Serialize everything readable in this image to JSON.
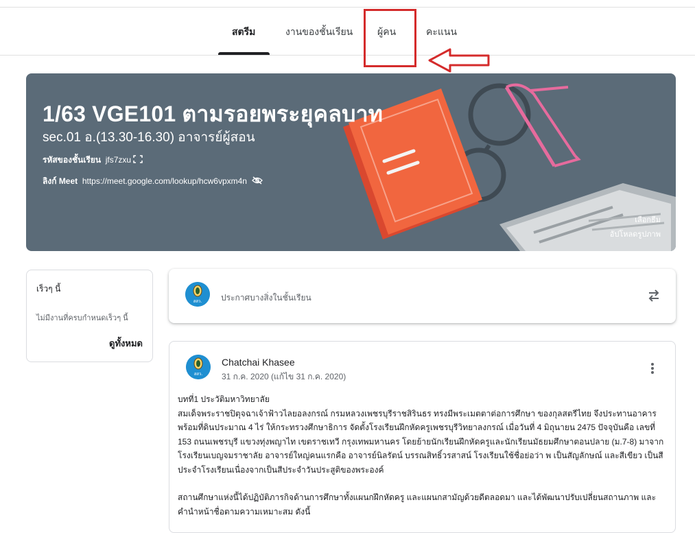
{
  "tabs": [
    "สตรีม",
    "งานของชั้นเรียน",
    "ผู้คน",
    "คะแนน"
  ],
  "banner": {
    "title": "1/63 VGE101 ตามรอยพระยุคลบาท",
    "section": "sec.01 อ.(13.30-16.30) อาจารย์ผู้สอน",
    "code_label": "รหัสของชั้นเรียน",
    "code_value": "jfs7zxu",
    "meet_label": "ลิงก์ Meet",
    "meet_url": "https://meet.google.com/lookup/hcw6vpxm4n",
    "select_theme": "เลือกธีม",
    "upload_photo": "อัปโหลดรูปภาพ"
  },
  "upcoming": {
    "title": "เร็วๆ นี้",
    "none": "ไม่มีงานที่ครบกำหนดเร็วๆ นี้",
    "view_all": "ดูทั้งหมด"
  },
  "announce": {
    "placeholder": "ประกาศบางสิ่งในชั้นเรียน",
    "avatar_text": "สสว."
  },
  "post": {
    "author": "Chatchai Khasee",
    "date": "31 ก.ค. 2020 (แก้ไข 31 ก.ค. 2020)",
    "avatar_text": "สสว.",
    "paragraph1_lines": [
      "บทที่1 ประวัติมหาวิทยาลัย",
      "สมเด็จพระราชปิตุจฉาเจ้าฟ้าวไลยอลงกรณ์ กรมหลวงเพชรบุรีราชสิรินธร ทรงมีพระเมตตาต่อการศึกษา ของกุลสตรีไทย จึงประทานอาคาร",
      "พร้อมที่ดินประมาณ 4 ไร่ ให้กระทรวงศึกษาธิการ จัดตั้งโรงเรียนฝึกหัดครูเพชรบุรีวิทยาลงกรณ์ เมื่อวันที่ 4 มิถุนายน 2475 ปัจจุบันคือ เลขที่",
      "153 ถนนเพชรบุรี แขวงทุ่งพญาไท เขตราชเทวี กรุงเทพมหานคร โดยย้ายนักเรียนฝึกหัดครูและนักเรียนมัธยมศึกษาตอนปลาย (ม.7-8) มาจาก",
      "โรงเรียนเบญจมราชาลัย อาจารย์ใหญ่คนแรกคือ อาจารย์นิลรัตน์ บรรณสิทธิ์วรสาสน์ โรงเรียนใช้ชื่อย่อว่า พ เป็นสัญลักษณ์ และสีเขียว เป็นสี",
      "ประจำโรงเรียนเนื่องจากเป็นสีประจำวันประสูติของพระองค์"
    ],
    "paragraph2_lines": [
      "สถานศึกษาแห่งนี้ได้ปฏิบัติภารกิจด้านการศึกษาทั้งแผนกฝึกหัดครู และแผนกสามัญด้วยดีตลอดมา และได้พัฒนาปรับเปลี่ยนสถานภาพ และ",
      "คำนำหน้าชื่อตามความเหมาะสม ดังนี้"
    ]
  }
}
